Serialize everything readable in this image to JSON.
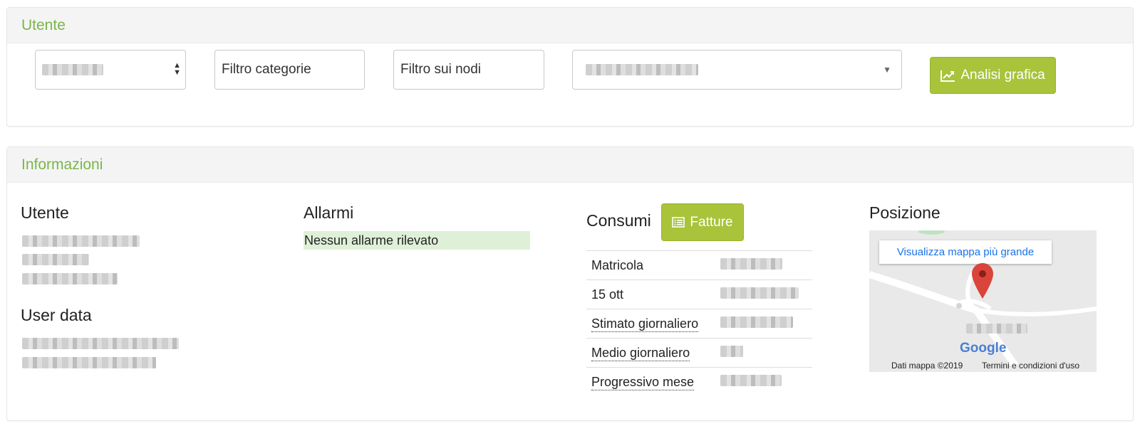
{
  "utente_panel": {
    "title": "Utente",
    "category_filter_placeholder": "Filtro categorie",
    "node_filter_placeholder": "Filtro sui nodi",
    "graph_button_label": "Analisi grafica"
  },
  "info_panel": {
    "title": "Informazioni",
    "user_heading": "Utente",
    "user_data_heading": "User data",
    "alarms_heading": "Allarmi",
    "alarm_status": "Nessun allarme rilevato",
    "consumption_heading": "Consumi",
    "invoices_button_label": "Fatture",
    "consumption_rows": [
      {
        "label": "Matricola"
      },
      {
        "label": "15 ott"
      },
      {
        "label": "Stimato giornaliero"
      },
      {
        "label": "Medio giornaliero"
      },
      {
        "label": "Progressivo mese"
      }
    ],
    "position_heading": "Posizione",
    "map_link": "Visualizza mappa più grande",
    "map_data_credit": "Dati mappa ©2019",
    "map_terms": "Termini e condizioni d'uso",
    "map_logo": "Google"
  },
  "colors": {
    "accent_green": "#7ab648",
    "button_green": "#a9c33a",
    "alarm_ok_bg": "#dff0d8",
    "map_marker": "#d9453a"
  }
}
